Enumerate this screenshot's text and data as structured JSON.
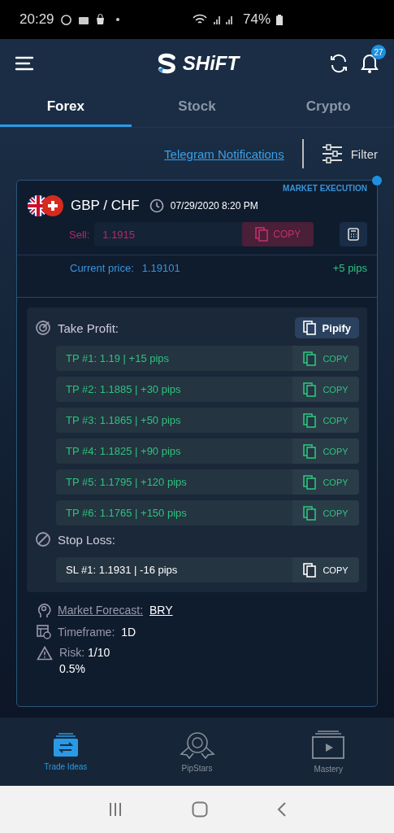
{
  "status_bar": {
    "time": "20:29",
    "battery": "74%"
  },
  "header": {
    "logo": "SHiFT",
    "notification_count": "27"
  },
  "tabs": [
    {
      "label": "Forex",
      "selected": true
    },
    {
      "label": "Stock",
      "selected": false
    },
    {
      "label": "Crypto",
      "selected": false
    }
  ],
  "toolbar": {
    "telegram_link": "Telegram Notifications",
    "filter": "Filter"
  },
  "signal": {
    "execution": "MARKET EXECUTION",
    "pair": "GBP / CHF",
    "datetime": "07/29/2020 8:20 PM",
    "entry_label": "Sell:",
    "entry_value": "1.1915",
    "entry_copy": "COPY",
    "current_price_label": "Current price:",
    "current_price": "1.19101",
    "pips": "+5 pips"
  },
  "take_profit": {
    "title": "Take Profit:",
    "pipify": "Pipify",
    "targets": [
      {
        "text": "TP #1: 1.19 | +15 pips",
        "copy": "COPY"
      },
      {
        "text": "TP #2: 1.1885 | +30 pips",
        "copy": "COPY"
      },
      {
        "text": "TP #3: 1.1865 | +50 pips",
        "copy": "COPY"
      },
      {
        "text": "TP #4: 1.1825 | +90 pips",
        "copy": "COPY"
      },
      {
        "text": "TP #5: 1.1795 | +120 pips",
        "copy": "COPY"
      },
      {
        "text": "TP #6: 1.1765 | +150 pips",
        "copy": "COPY"
      }
    ]
  },
  "stop_loss": {
    "title": "Stop Loss:",
    "levels": [
      {
        "text": "SL #1: 1.1931 | -16 pips",
        "copy": "COPY"
      }
    ]
  },
  "details": {
    "forecast_label": "Market Forecast:",
    "forecast_value": "BRY",
    "timeframe_label": "Timeframe:",
    "timeframe_value": "1D",
    "risk_label": "Risk:",
    "risk_value": "1/10",
    "risk_percent": "0.5%"
  },
  "bottom_nav": [
    {
      "label": "Trade Ideas",
      "selected": true
    },
    {
      "label": "PipStars",
      "selected": false
    },
    {
      "label": "Mastery",
      "selected": false
    }
  ]
}
